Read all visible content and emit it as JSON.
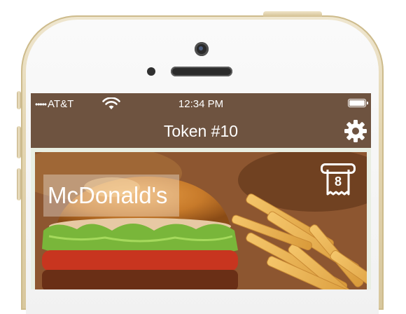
{
  "status_bar": {
    "signal_dots": "•••••",
    "carrier": "AT&T",
    "wifi_icon": "wifi-icon",
    "time": "12:34 PM",
    "battery_icon": "battery-icon"
  },
  "nav": {
    "title": "Token #10",
    "settings_icon": "gear-icon"
  },
  "card": {
    "restaurant_name": "McDonald's",
    "ticket_icon": "ticket-icon",
    "ticket_number": "8"
  },
  "colors": {
    "bar_brown": "#6e5340",
    "screen_bg": "#e9eee2",
    "phone_gold": "#e4d6b2"
  }
}
